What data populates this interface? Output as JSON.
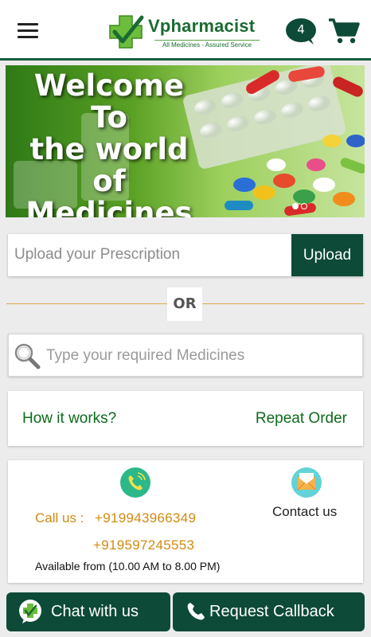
{
  "header": {
    "brand_name": "Vpharmacist",
    "brand_tagline": "All Medicines - Assured Service",
    "cart_count": "4"
  },
  "banner": {
    "line1": "Welcome",
    "line2": "To",
    "line3": "the world of",
    "line4": "Medicines",
    "slides": 2,
    "active_slide": 1
  },
  "upload": {
    "placeholder": "Upload your Prescription",
    "button_label": "Upload"
  },
  "separator": {
    "label": "OR"
  },
  "search": {
    "placeholder": "Type your required Medicines"
  },
  "links": {
    "how_it_works": "How it works?",
    "repeat_order": "Repeat Order"
  },
  "contact": {
    "call_label": "Call us :",
    "phone_1": "+919943966349",
    "phone_2": "+919597245553",
    "availability": "Available from (10.00 AM to 8.00 PM)",
    "contact_label": "Contact us"
  },
  "bottom_bar": {
    "chat_label": "Chat with us",
    "callback_label": "Request Callback"
  },
  "colors": {
    "primary_dark_green": "#0d4a37",
    "link_green": "#0d6a1c",
    "phone_orange": "#d28a12",
    "divider_orange": "#e0a84e"
  },
  "icons": [
    "menu-icon",
    "logo-cross-icon",
    "chat-bubble-icon",
    "cart-icon",
    "search-icon",
    "phone-icon",
    "mail-icon",
    "chat-icon",
    "call-icon"
  ]
}
